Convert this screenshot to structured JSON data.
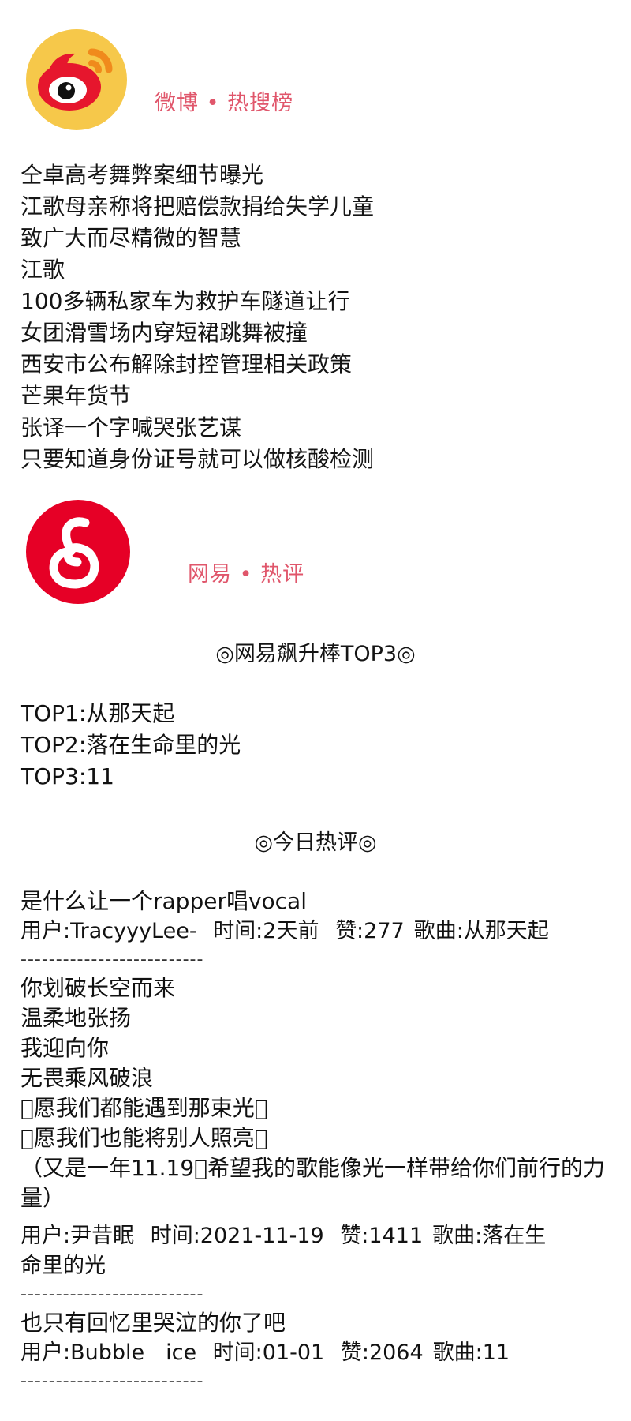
{
  "weibo": {
    "title": "微博 • 热搜榜",
    "logo_icon": "weibo-logo-icon",
    "colors": {
      "accent": "#e0566b",
      "logo_bg": "#f5c94b",
      "logo_red": "#e6162d",
      "logo_orange": "#f39a1e"
    },
    "items": [
      "仝卓高考舞弊案细节曝光",
      "江歌母亲称将把赔偿款捐给失学儿童",
      "致广大而尽精微的智慧",
      "江歌",
      "100多辆私家车为救护车隧道让行",
      "女团滑雪场内穿短裙跳舞被撞",
      "西安市公布解除封控管理相关政策",
      "芒果年货节",
      "张译一个字喊哭张艺谋",
      "只要知道身份证号就可以做核酸检测"
    ]
  },
  "netease": {
    "title": "网易 • 热评",
    "logo_icon": "netease-music-logo-icon",
    "colors": {
      "logo_red": "#e60026"
    },
    "top_heading": "◎网易飙升棒TOP3◎",
    "top_items": [
      "TOP1:从那天起",
      "TOP2:落在生命里的光",
      "TOP3:11"
    ],
    "today_heading": "◎今日热评◎",
    "divider": "--------------------------",
    "comments": [
      {
        "lines": [
          "是什么让一个rapper唱vocal"
        ],
        "user": "用户:TracyyyLee-",
        "time": "时间:2天前",
        "likes": "赞:277",
        "song": "歌曲:从那天起"
      },
      {
        "lines": [
          "你划破长空而来",
          "温柔地张扬",
          "我迎向你",
          "无畏乘风破浪",
          "󾓮愿我们都能遇到那束光󾓮",
          "󾓮愿我们也能将别人照亮󾓮",
          "（又是一年11.19󾓮希望我的歌能像光一样带给你们前行的力量）"
        ],
        "user": "用户:尹昔眠",
        "time": "时间:2021-11-19",
        "likes": "赞:1411",
        "song": "歌曲:落在生命里的光"
      },
      {
        "lines": [
          "也只有回忆里哭泣的你了吧"
        ],
        "user": "用户:Bubble　ice",
        "time": "时间:01-01",
        "likes": "赞:2064",
        "song": "歌曲:11"
      }
    ]
  }
}
